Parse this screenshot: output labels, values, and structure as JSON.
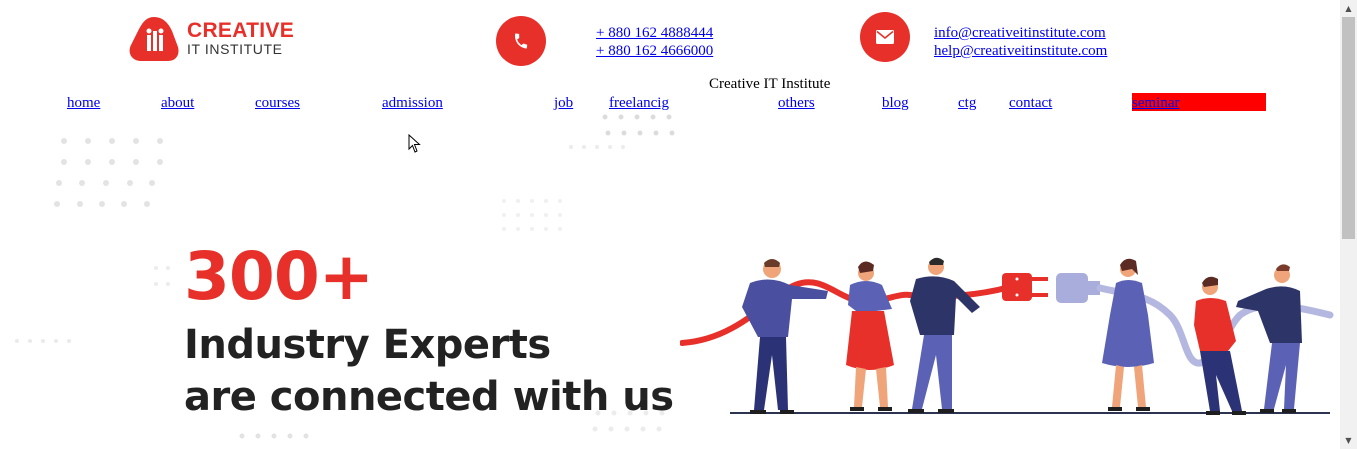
{
  "logo": {
    "line1": "CREATIVE",
    "line2": "IT INSTITUTE",
    "mark": "iti"
  },
  "phones": [
    "+ 880 162 4888444",
    "+ 880 162 4666000"
  ],
  "emails": [
    "info@creativeitinstitute.com",
    "help@creativeitinstitute.com"
  ],
  "site_name": "Creative IT Institute",
  "nav": {
    "home": "home",
    "about": "about",
    "courses": "courses",
    "admission": "admission",
    "job": "job",
    "freelancig": "freelancig",
    "others": "others",
    "blog": "blog",
    "ctg": "ctg",
    "contact": "contact",
    "seminar": "seminar"
  },
  "hero": {
    "number": "300+",
    "line1": "Industry Experts",
    "line2": "are connected with us"
  },
  "colors": {
    "brand_red": "#e8302a",
    "link": "#0000ee",
    "seminar_bg": "#ff0000"
  },
  "icons": {
    "phone": "phone-icon",
    "email": "envelope-icon"
  }
}
